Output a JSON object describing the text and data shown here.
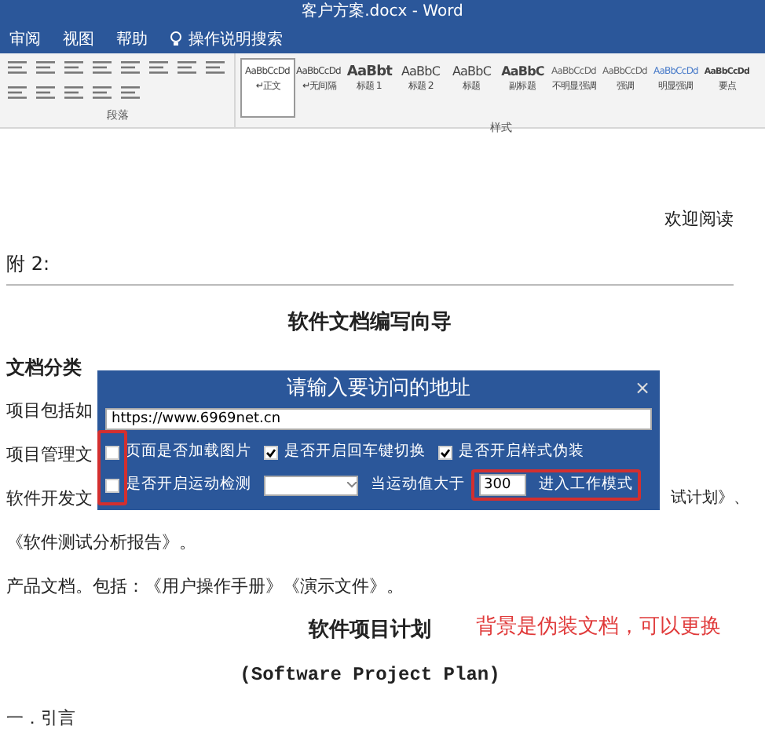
{
  "window": {
    "title": "客户方案.docx - Word"
  },
  "menu": [
    {
      "label": "审阅",
      "kind": "tab"
    },
    {
      "label": "视图",
      "kind": "tab"
    },
    {
      "label": "帮助",
      "kind": "tab"
    },
    {
      "label": "操作说明搜索",
      "kind": "search"
    }
  ],
  "ribbon": {
    "paragraph_group": "段落",
    "styles_group": "样式",
    "styles": [
      {
        "preview": "AaBbCcDd",
        "label": "↵正文",
        "kind": "small",
        "selected": true
      },
      {
        "preview": "AaBbCcDd",
        "label": "↵无间隔",
        "kind": "small",
        "selected": false
      },
      {
        "preview": "AaBbt",
        "label": "标题 1",
        "kind": "heading1",
        "selected": false
      },
      {
        "preview": "AaBbC",
        "label": "标题 2",
        "kind": "heading",
        "selected": false
      },
      {
        "preview": "AaBbC",
        "label": "标题",
        "kind": "heading",
        "selected": false
      },
      {
        "preview": "AaBbC",
        "label": "副标题",
        "kind": "strong",
        "selected": false
      },
      {
        "preview": "AaBbCcDd",
        "label": "不明显强调",
        "kind": "faint",
        "selected": false
      },
      {
        "preview": "AaBbCcDd",
        "label": "强调",
        "kind": "faint",
        "selected": false
      },
      {
        "preview": "AaBbCcDd",
        "label": "明显强调",
        "kind": "accent",
        "selected": false
      },
      {
        "preview": "AaBbCcDd",
        "label": "要点",
        "kind": "bold",
        "selected": false
      }
    ]
  },
  "document": {
    "lines": [
      {
        "kind": "right",
        "text": "欢迎阅读"
      },
      {
        "kind": "rule",
        "text": "附 2:"
      },
      {
        "kind": "title",
        "text": "软件文档编写向导"
      },
      {
        "kind": "heading",
        "text": "文档分类"
      },
      {
        "kind": "body",
        "text": "项目包括如"
      },
      {
        "kind": "body",
        "text": "项目管理文"
      },
      {
        "kind": "split",
        "text": "软件开发文",
        "tail": "试计划》、"
      },
      {
        "kind": "body",
        "text": "《软件测试分析报告》。"
      },
      {
        "kind": "body",
        "text": "产品文档。包括：《用户操作手册》《演示文件》。"
      },
      {
        "kind": "title",
        "text": "软件项目计划"
      },
      {
        "kind": "mono",
        "text": "(Software Project Plan)"
      },
      {
        "kind": "body",
        "text": "一．引言"
      }
    ]
  },
  "annotation": "背景是伪装文档，可以更换",
  "dialog": {
    "title": "请输入要访问的地址",
    "close": "×",
    "url": "https://www.6969net.cn",
    "options": [
      {
        "label": "页面是否加载图片",
        "checked": false
      },
      {
        "label": "是否开启回车键切换",
        "checked": true
      },
      {
        "label": "是否开启样式伪装",
        "checked": true
      }
    ],
    "motion": {
      "label": "是否开启运动检测",
      "checked": false,
      "threshold_label": "当运动值大于",
      "threshold": "300",
      "mode_label": "进入工作模式"
    }
  }
}
